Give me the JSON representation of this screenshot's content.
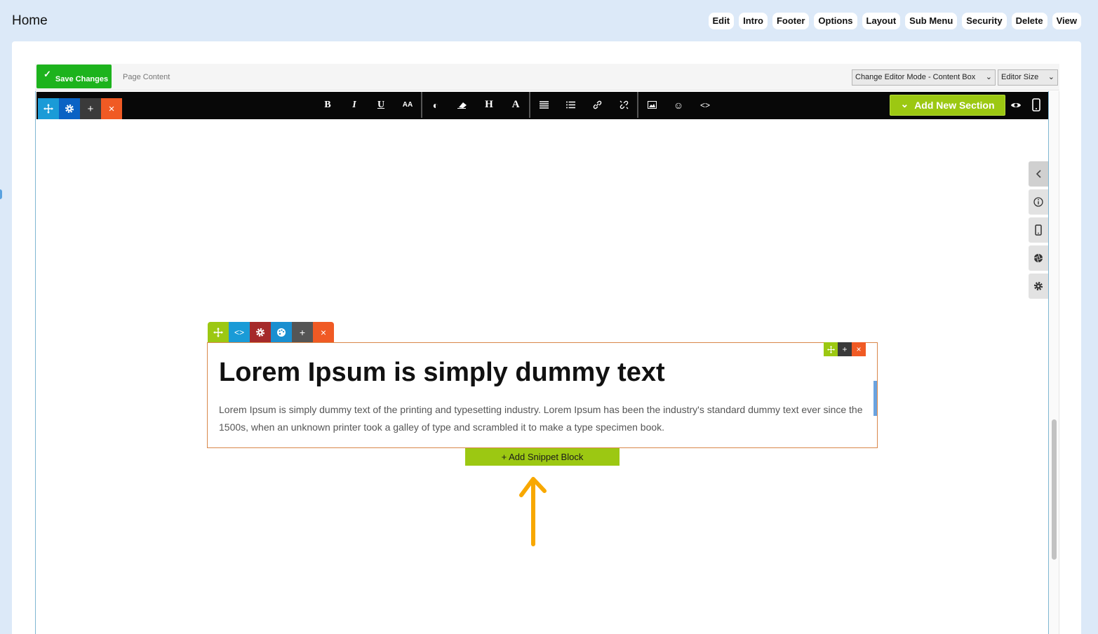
{
  "header": {
    "title": "Home",
    "nav": [
      "Edit",
      "Intro",
      "Footer",
      "Options",
      "Layout",
      "Sub Menu",
      "Security",
      "Delete",
      "View"
    ]
  },
  "editor": {
    "save_label": "Save Changes",
    "page_content_label": "Page Content",
    "editor_mode": "Change Editor Mode - Content Box",
    "editor_size": "Editor Size"
  },
  "toolbar": {
    "add_section_label": "Add New Section",
    "format_buttons": [
      "bold",
      "italic",
      "underline",
      "font-size",
      "contrast",
      "eraser",
      "heading",
      "font-color",
      "align",
      "list",
      "link",
      "unlink",
      "image",
      "emoji",
      "code"
    ]
  },
  "block": {
    "heading": "Lorem Ipsum is simply dummy text",
    "body": "Lorem Ipsum is simply dummy text of the printing and typesetting industry. Lorem Ipsum has been the industry's standard dummy text ever since the 1500s, when an unknown printer took a galley of type and scrambled it to make a type specimen book.",
    "add_snippet_label": "+ Add Snippet Block"
  },
  "colors": {
    "accent_green": "#9cc812",
    "save_green": "#1db31d",
    "delete_orange": "#f05a24",
    "move_blue": "#1a9bd7",
    "settings_blue": "#0a62c4",
    "arrow_orange": "#f8a800"
  }
}
